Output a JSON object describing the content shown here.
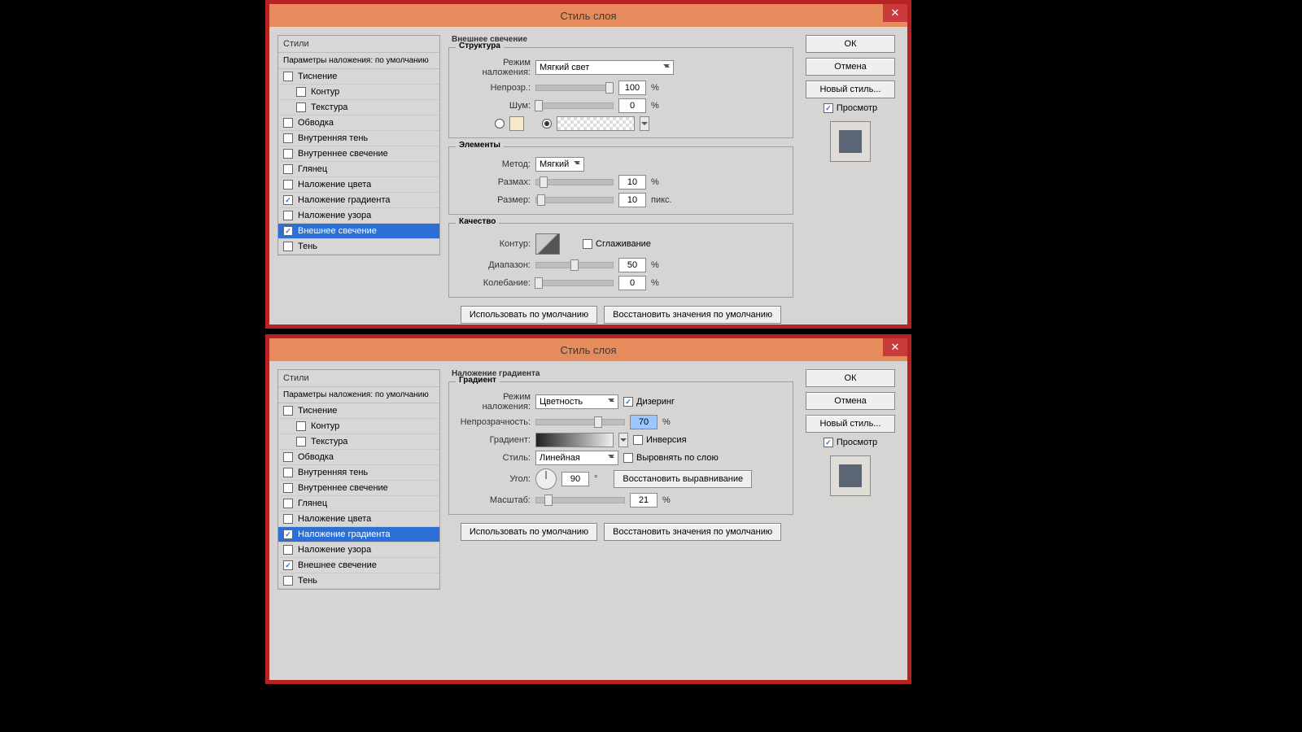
{
  "dialog_title": "Стиль слоя",
  "close_symbol": "✕",
  "styles_header": "Стили",
  "styles_sub": "Параметры наложения: по умолчанию",
  "style_items": [
    {
      "label": "Тиснение",
      "checked": false,
      "indent": false
    },
    {
      "label": "Контур",
      "checked": false,
      "indent": true
    },
    {
      "label": "Текстура",
      "checked": false,
      "indent": true
    },
    {
      "label": "Обводка",
      "checked": false,
      "indent": false
    },
    {
      "label": "Внутренняя тень",
      "checked": false,
      "indent": false
    },
    {
      "label": "Внутреннее свечение",
      "checked": false,
      "indent": false
    },
    {
      "label": "Глянец",
      "checked": false,
      "indent": false
    },
    {
      "label": "Наложение цвета",
      "checked": false,
      "indent": false
    },
    {
      "label": "Наложение градиента",
      "checked": true,
      "indent": false
    },
    {
      "label": "Наложение узора",
      "checked": false,
      "indent": false
    },
    {
      "label": "Внешнее свечение",
      "checked": true,
      "indent": false
    },
    {
      "label": "Тень",
      "checked": false,
      "indent": false
    }
  ],
  "panel1": {
    "title": "Внешнее свечение",
    "group_structure": "Структура",
    "blend_mode_label": "Режим наложения:",
    "blend_mode_value": "Мягкий свет",
    "opacity_label": "Непрозр.:",
    "opacity_value": "100",
    "noise_label": "Шум:",
    "noise_value": "0",
    "group_elements": "Элементы",
    "technique_label": "Метод:",
    "technique_value": "Мягкий",
    "spread_label": "Размах:",
    "spread_value": "10",
    "size_label": "Размер:",
    "size_value": "10",
    "size_unit": "пикс.",
    "group_quality": "Качество",
    "contour_label": "Контур:",
    "antialias_label": "Сглаживание",
    "range_label": "Диапазон:",
    "range_value": "50",
    "jitter_label": "Колебание:",
    "jitter_value": "0",
    "percent": "%",
    "btn_default": "Использовать по умолчанию",
    "btn_reset": "Восстановить значения по умолчанию"
  },
  "panel2": {
    "title": "Наложение градиента",
    "group_gradient": "Градиент",
    "blend_mode_label": "Режим наложения:",
    "blend_mode_value": "Цветность",
    "dither_label": "Дизеринг",
    "opacity_label": "Непрозрачность:",
    "opacity_value": "70",
    "gradient_label": "Градиент:",
    "invert_label": "Инверсия",
    "style_label": "Стиль:",
    "style_value": "Линейная",
    "align_label": "Выровнять по слою",
    "angle_label": "Угол:",
    "angle_value": "90",
    "deg": "°",
    "reset_align": "Восстановить выравнивание",
    "scale_label": "Масштаб:",
    "scale_value": "21",
    "percent": "%",
    "btn_default": "Использовать по умолчанию",
    "btn_reset": "Восстановить значения по умолчанию"
  },
  "right": {
    "ok": "ОК",
    "cancel": "Отмена",
    "new_style": "Новый стиль...",
    "preview": "Просмотр"
  }
}
